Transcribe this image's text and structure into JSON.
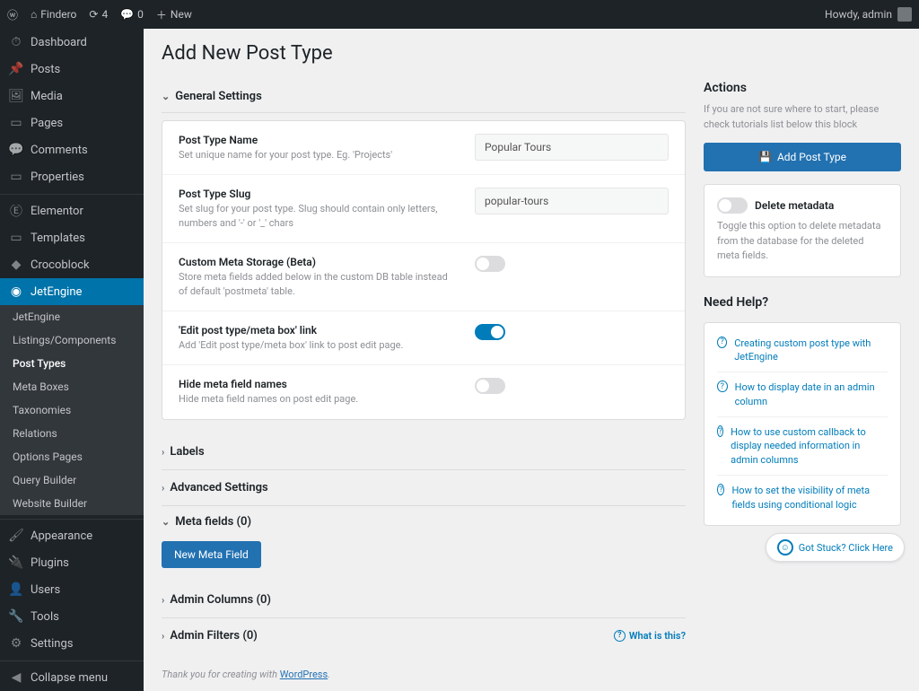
{
  "topbar": {
    "site_name": "Findero",
    "updates_count": "4",
    "comments_count": "0",
    "new_label": "New",
    "howdy": "Howdy, admin"
  },
  "sidebar": {
    "items": [
      {
        "icon": "⏱",
        "label": "Dashboard"
      },
      {
        "icon": "📌",
        "label": "Posts"
      },
      {
        "icon": "🖼",
        "label": "Media"
      },
      {
        "icon": "▭",
        "label": "Pages"
      },
      {
        "icon": "💬",
        "label": "Comments"
      },
      {
        "icon": "▭",
        "label": "Properties"
      },
      {
        "icon": "Ⓔ",
        "label": "Elementor"
      },
      {
        "icon": "▭",
        "label": "Templates"
      },
      {
        "icon": "◆",
        "label": "Crocoblock"
      },
      {
        "icon": "◉",
        "label": "JetEngine"
      }
    ],
    "submenu": [
      "JetEngine",
      "Listings/Components",
      "Post Types",
      "Meta Boxes",
      "Taxonomies",
      "Relations",
      "Options Pages",
      "Query Builder",
      "Website Builder"
    ],
    "items2": [
      {
        "icon": "🖌",
        "label": "Appearance"
      },
      {
        "icon": "🔌",
        "label": "Plugins"
      },
      {
        "icon": "👤",
        "label": "Users"
      },
      {
        "icon": "🔧",
        "label": "Tools"
      },
      {
        "icon": "⚙",
        "label": "Settings"
      },
      {
        "icon": "◀",
        "label": "Collapse menu"
      }
    ]
  },
  "page": {
    "title": "Add New Post Type",
    "sections": {
      "general": "General Settings",
      "labels": "Labels",
      "advanced": "Advanced Settings",
      "meta_fields": "Meta fields (0)",
      "admin_columns": "Admin Columns (0)",
      "admin_filters": "Admin Filters (0)"
    },
    "fields": {
      "name": {
        "title": "Post Type Name",
        "desc": "Set unique name for your post type. Eg. 'Projects'",
        "value": "Popular Tours"
      },
      "slug": {
        "title": "Post Type Slug",
        "desc": "Set slug for your post type. Slug should contain only letters, numbers and '-' or '_' chars",
        "value": "popular-tours"
      },
      "storage": {
        "title": "Custom Meta Storage (Beta)",
        "desc": "Store meta fields added below in the custom DB table instead of default 'postmeta' table."
      },
      "editlink": {
        "title": "'Edit post type/meta box' link",
        "desc": "Add 'Edit post type/meta box' link to post edit page."
      },
      "hidemeta": {
        "title": "Hide meta field names",
        "desc": "Hide meta field names on post edit page."
      }
    },
    "new_meta_btn": "New Meta Field",
    "what_is_this": "What is this?"
  },
  "aside": {
    "actions": {
      "title": "Actions",
      "desc": "If you are not sure where to start, please check tutorials list below this block",
      "add_btn": "Add Post Type",
      "delete_meta_title": "Delete metadata",
      "delete_meta_desc": "Toggle this option to delete metadata from the database for the deleted meta fields."
    },
    "help": {
      "title": "Need Help?",
      "links": [
        "Creating custom post type with JetEngine",
        "How to display date in an admin column",
        "How to use custom callback to display needed information in admin columns",
        "How to set the visibility of meta fields using conditional logic"
      ]
    }
  },
  "footer": {
    "text": "Thank you for creating with ",
    "link": "WordPress"
  },
  "stuck": "Got Stuck? Click Here"
}
